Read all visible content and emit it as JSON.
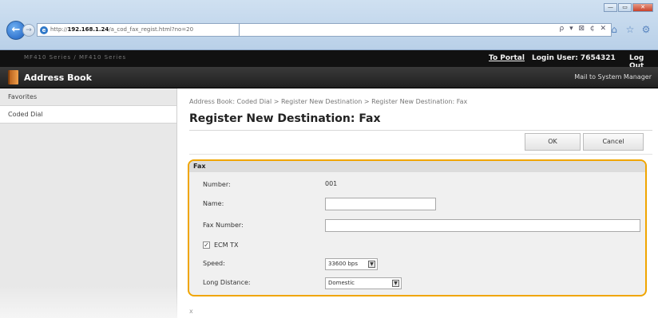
{
  "browser": {
    "address_prefix": "http://",
    "address_host": "192.168.1.24",
    "address_rest": "/a_cod_fax_regist.html?no=20",
    "search_tools": "ρ ▾ ⊠ ¢ ✕",
    "back_glyph": "←",
    "window_controls": [
      "—",
      "▭",
      "✕"
    ],
    "toolbar_icons": [
      "home-icon",
      "favorites-star-icon",
      "tools-gear-icon"
    ]
  },
  "topbar": {
    "device_name": "MF410 Series / MF410 Series",
    "portal_link": "To Portal",
    "login_user": "Login User:  7654321",
    "logout": "Log Out"
  },
  "titlebar": {
    "title": "Address Book",
    "mail_link": "Mail to System Manager"
  },
  "sidebar": {
    "items": [
      {
        "label": "Favorites",
        "active": false
      },
      {
        "label": "Coded Dial",
        "active": true
      }
    ]
  },
  "main": {
    "breadcrumb": "Address Book: Coded Dial > Register New Destination > Register New Destination: Fax",
    "title": "Register New Destination: Fax",
    "ok_label": "OK",
    "cancel_label": "Cancel"
  },
  "panel": {
    "heading": "Fax",
    "number_label": "Number:",
    "number_value": "001",
    "name_label": "Name:",
    "name_value": "",
    "fax_number_label": "Fax Number:",
    "fax_number_value": "",
    "ecm_label": "ECM TX",
    "ecm_checked": true,
    "speed_label": "Speed:",
    "speed_value": "33600 bps",
    "long_distance_label": "Long Distance:",
    "long_distance_value": "Domestic"
  },
  "accent_color": "#f0a500",
  "footer_mark": "x"
}
